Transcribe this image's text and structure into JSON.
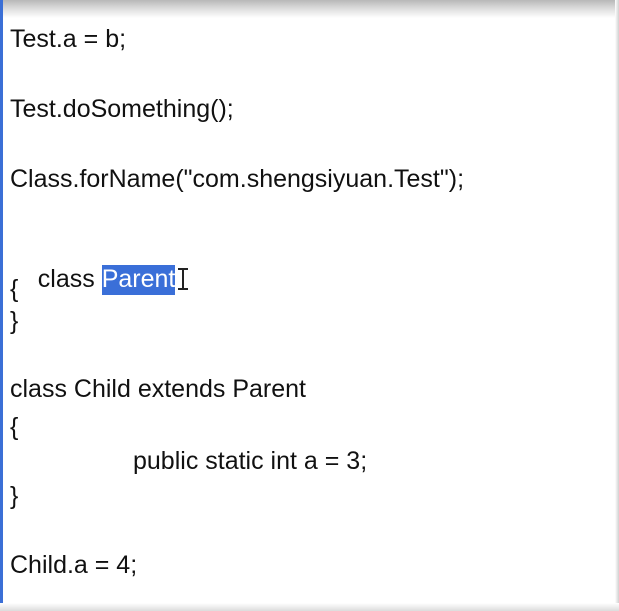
{
  "code": {
    "line1": "Test.a = b;",
    "line2": "Test.doSomething();",
    "line3": "Class.forName(\"com.shengsiyuan.Test\");",
    "line4_keyword": "class ",
    "line4_selected": "Parent",
    "line5": "{",
    "line6": "}",
    "line7": "class Child extends Parent",
    "line8": "{",
    "line9": "public static int a = 3;",
    "line10": "}",
    "line11": "Child.a = 4;"
  },
  "colors": {
    "selection": "#3a6fd8",
    "left_border": "#3b6fd6",
    "text": "#111111"
  },
  "cursor": "text-ibeam-cursor-icon"
}
